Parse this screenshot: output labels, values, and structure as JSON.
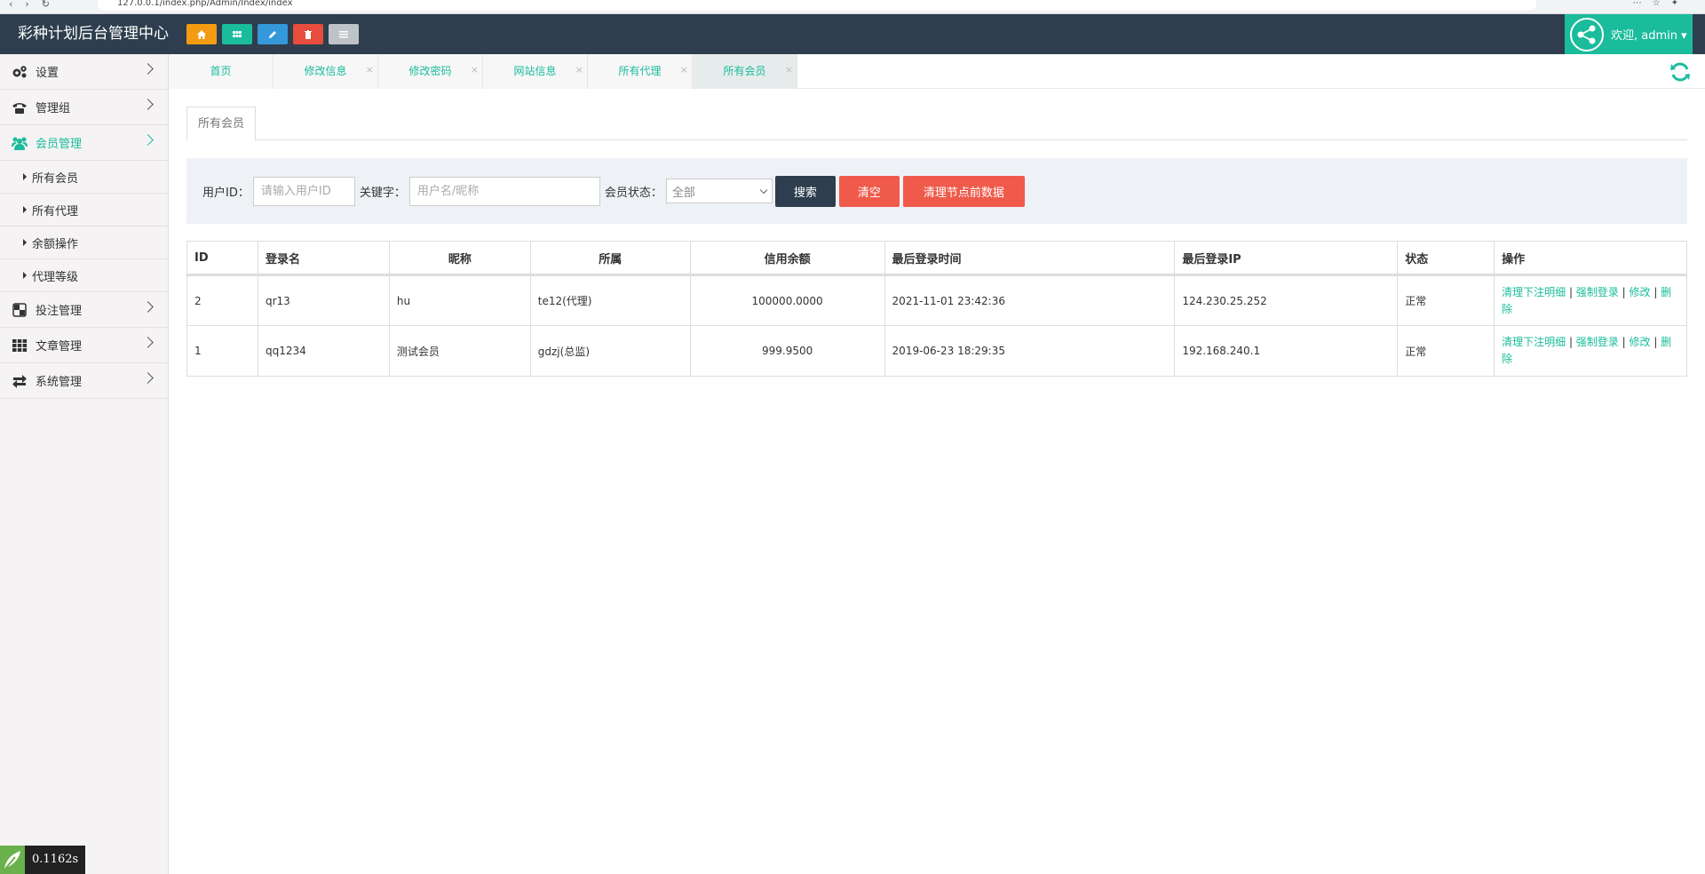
{
  "browser": {
    "url": "127.0.0.1/index.php/Admin/Index/index"
  },
  "header": {
    "brand": "彩种计划后台管理中心",
    "quick_buttons": [
      "home-icon",
      "grid-icon",
      "edit-icon",
      "trash-icon",
      "list-icon"
    ],
    "user_label": "欢迎, admin ▾"
  },
  "sidebar": {
    "items": [
      {
        "label": "设置",
        "icon": "gear-icon"
      },
      {
        "label": "管理组",
        "icon": "phone-icon"
      },
      {
        "label": "会员管理",
        "icon": "users-icon",
        "active": true
      },
      {
        "label": "投注管理",
        "icon": "dice-icon"
      },
      {
        "label": "文章管理",
        "icon": "grid-icon"
      },
      {
        "label": "系统管理",
        "icon": "exchange-icon"
      }
    ],
    "sub_items": [
      "所有会员",
      "所有代理",
      "余额操作",
      "代理等级"
    ]
  },
  "tabs": [
    {
      "label": "首页"
    },
    {
      "label": "修改信息"
    },
    {
      "label": "修改密码"
    },
    {
      "label": "网站信息"
    },
    {
      "label": "所有代理"
    },
    {
      "label": "所有会员",
      "active": true
    }
  ],
  "tab_close": "×",
  "content_tab": "所有会员",
  "search": {
    "user_id_label": "用户ID：",
    "user_id_placeholder": "请输入用户ID",
    "keyword_label": "关键字：",
    "keyword_placeholder": "用户名/昵称",
    "status_label": "会员状态：",
    "status_value": "全部",
    "search_button": "搜索",
    "clear_button": "清空",
    "purge_button": "清理节点前数据"
  },
  "table": {
    "headers": [
      "ID",
      "登录名",
      "昵称",
      "所属",
      "信用余额",
      "最后登录时间",
      "最后登录IP",
      "状态",
      "操作"
    ],
    "rows": [
      {
        "id": "2",
        "login": "qr13",
        "nick": "hu",
        "owner": "te12(代理)",
        "balance": "100000.0000",
        "last_time": "2021-11-01 23:42:36",
        "last_ip": "124.230.25.252",
        "status": "正常"
      },
      {
        "id": "1",
        "login": "qq1234",
        "nick": "测试会员",
        "owner": "gdzj(总监)",
        "balance": "999.9500",
        "last_time": "2019-06-23 18:29:35",
        "last_ip": "192.168.240.1",
        "status": "正常"
      }
    ],
    "ops": {
      "clear_orders": "清理下注明细",
      "force_login": "强制登录",
      "edit": "修改",
      "delete_a": "删",
      "delete_b": "除",
      "sep": " | "
    }
  },
  "timer": "0.1162s",
  "colors": {
    "header": "#2e3e4e",
    "accent": "#1abc9c",
    "danger": "#ef5a4b"
  }
}
